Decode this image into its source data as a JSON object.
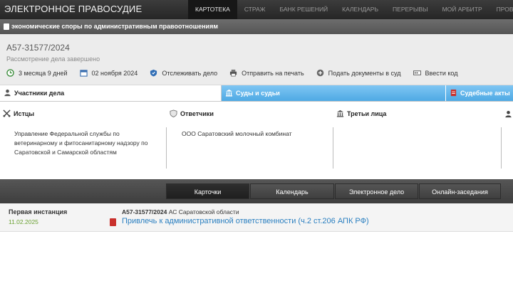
{
  "header": {
    "brand": "ЭЛЕКТРОННОЕ ПРАВОСУДИЕ",
    "nav": [
      {
        "label": "КАРТОТЕКА",
        "active": true
      },
      {
        "label": "СТРАЖ",
        "active": false
      },
      {
        "label": "БАНК РЕШЕНИЙ",
        "active": false
      },
      {
        "label": "КАЛЕНДАРЬ",
        "active": false
      },
      {
        "label": "ПЕРЕРЫВЫ",
        "active": false
      },
      {
        "label": "МОЙ АРБИТР",
        "active": false
      },
      {
        "label": "ПРОВЕР",
        "active": false
      }
    ]
  },
  "category": "экономические споры по административным правоотношениям",
  "case": {
    "number": "А57-31577/2024",
    "status": "Рассмотрение дела завершено",
    "actions": [
      {
        "label": "3 месяца 9 дней",
        "icon": "clock-icon"
      },
      {
        "label": "02 ноября 2024",
        "icon": "calendar-icon"
      },
      {
        "label": "Отслеживать дело",
        "icon": "shield-icon"
      },
      {
        "label": "Отправить на печать",
        "icon": "printer-icon"
      },
      {
        "label": "Подать документы в суд",
        "icon": "plus-circle-icon"
      },
      {
        "label": "Ввести код",
        "icon": "code-icon"
      }
    ]
  },
  "tabs": {
    "parties": "Участники дела",
    "courts": "Суды и судьи",
    "acts": "Судебные акты"
  },
  "parties": {
    "plaintiffs_title": "Истцы",
    "plaintiffs": "Управление Федеральной службы по ветеринарному и фитосанитарному надзору по Саратовской и Самарской областям",
    "defendants_title": "Ответчики",
    "defendants": "ООО Саратовский молочный комбинат",
    "third_title": "Третьи лица"
  },
  "bottom_tabs": [
    {
      "label": "Карточки",
      "active": true
    },
    {
      "label": "Календарь",
      "active": false
    },
    {
      "label": "Электронное дело",
      "active": false
    },
    {
      "label": "Онлайн-заседания",
      "active": false
    }
  ],
  "instance": {
    "level": "Первая инстанция",
    "date": "11.02.2025",
    "case_number": "А57-31577/2024",
    "court": "АС Саратовской области",
    "link": "Привлечь к административной ответственности (ч.2 ст.206 АПК РФ)"
  },
  "colors": {
    "tab_blue": "#4ea9e4",
    "link_blue": "#2a7fc0",
    "date_green": "#6aa032",
    "dark_bar": "#3e3e3e"
  }
}
